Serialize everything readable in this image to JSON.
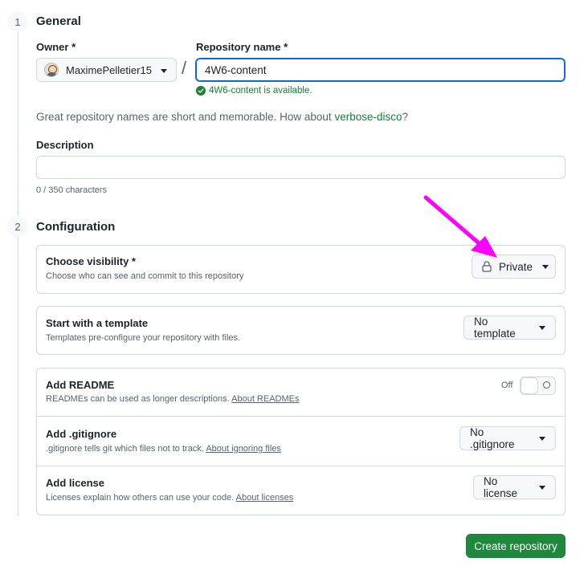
{
  "general": {
    "step_number": "1",
    "title": "General",
    "owner_label": "Owner *",
    "owner_value": "MaximePelletier15",
    "repo_label": "Repository name *",
    "repo_value": "4W6-content",
    "availability": "4W6-content is available.",
    "hint_prefix": "Great repository names are short and memorable. How about ",
    "hint_suggestion": "verbose-disco",
    "hint_suffix": "?",
    "description_label": "Description",
    "description_value": "",
    "char_count": "0 / 350 characters"
  },
  "configuration": {
    "step_number": "2",
    "title": "Configuration",
    "visibility": {
      "title": "Choose visibility *",
      "subtitle": "Choose who can see and commit to this repository",
      "value": "Private"
    },
    "template": {
      "title": "Start with a template",
      "subtitle": "Templates pre-configure your repository with files.",
      "value": "No template"
    },
    "readme": {
      "title": "Add README",
      "subtitle": "READMEs can be used as longer descriptions.",
      "link": "About READMEs",
      "toggle_label": "Off",
      "enabled": false
    },
    "gitignore": {
      "title": "Add .gitignore",
      "subtitle": ".gitignore tells git which files not to track.",
      "link": "About ignoring files",
      "value": "No .gitignore"
    },
    "license": {
      "title": "Add license",
      "subtitle": "Licenses explain how others can use your code.",
      "link": "About licenses",
      "value": "No license"
    }
  },
  "actions": {
    "create_label": "Create repository"
  },
  "colors": {
    "accent": "#0969da",
    "success": "#1a7f37",
    "primary_button": "#1f883d",
    "annotation_arrow": "#ff00ff"
  }
}
